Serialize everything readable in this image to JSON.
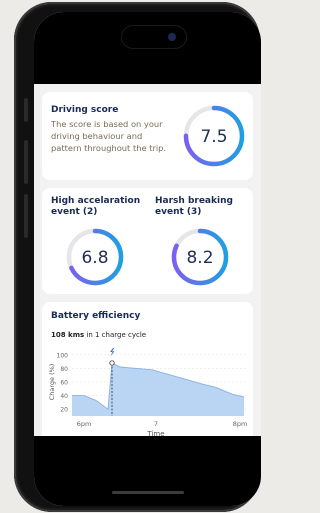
{
  "driving_score": {
    "title": "Driving score",
    "description": "The score is based on your driving behaviour and pattern throughout the trip.",
    "value": "7.5",
    "level": 0.75
  },
  "accel": {
    "title": "High accelaration event (2)",
    "value": "6.8",
    "level": 0.68
  },
  "braking": {
    "title": "Harsh breaking event (3)",
    "value": "8.2",
    "level": 0.82
  },
  "battery": {
    "title": "Battery efficiency",
    "distance": "108 kms",
    "distance_suffix": " in 1 charge cycle",
    "chart_data": {
      "type": "area",
      "xlabel": "Time",
      "ylabel": "Charge (%)",
      "yticks": [
        "100",
        "80",
        "60",
        "40",
        "20"
      ],
      "xticks": [
        "6pm",
        "7",
        "8pm"
      ],
      "ylim": [
        10,
        110
      ],
      "xlim": [
        6.0,
        8.2
      ],
      "x": [
        6.0,
        6.15,
        6.3,
        6.45,
        6.5,
        6.6,
        7.0,
        7.3,
        7.6,
        7.8,
        8.0,
        8.15
      ],
      "values": [
        40,
        40,
        33,
        20,
        88,
        82,
        78,
        68,
        58,
        52,
        42,
        38
      ],
      "charge_event_x": 6.5,
      "colors": {
        "fill": "#b9d5f3",
        "line": "#8cb0e0",
        "marker": "#3c6ee8"
      }
    }
  },
  "colors": {
    "gauge_start": "#7d5ff0",
    "gauge_end": "#1fa0e0",
    "track": "#e6e6ea",
    "title": "#1a2a55"
  }
}
